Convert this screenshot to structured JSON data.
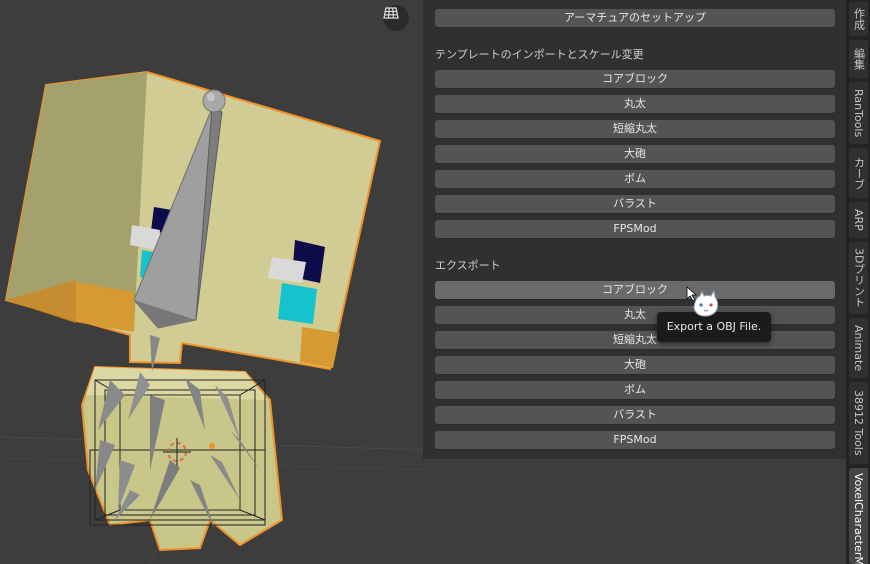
{
  "viewport": {
    "grid_toggle_icon": "grid-icon"
  },
  "panel": {
    "top_button": "アーマチュアのセットアップ",
    "import_section": {
      "label": "テンプレートのインポートとスケール変更",
      "buttons": [
        "コアブロック",
        "丸太",
        "短縮丸太",
        "大砲",
        "ボム",
        "バラスト",
        "FPSMod"
      ]
    },
    "export_section": {
      "label": "エクスポート",
      "buttons": [
        "コアブロック",
        "丸太",
        "短縮丸太",
        "大砲",
        "ボム",
        "バラスト",
        "FPSMod"
      ]
    }
  },
  "tooltip": {
    "text": "Export a OBJ File."
  },
  "tabs": [
    "作成",
    "編集",
    "RanTools",
    "カーブ",
    "ARP",
    "3Dプリント",
    "Animate",
    "38912 Tools",
    "VoxelCharacterMa"
  ],
  "active_tab": "VoxelCharacterMa",
  "colors": {
    "accent_outline": "#f0922b",
    "panel_bg": "#303030",
    "button_bg": "#545454",
    "viewport_bg": "#3d3d3d"
  }
}
